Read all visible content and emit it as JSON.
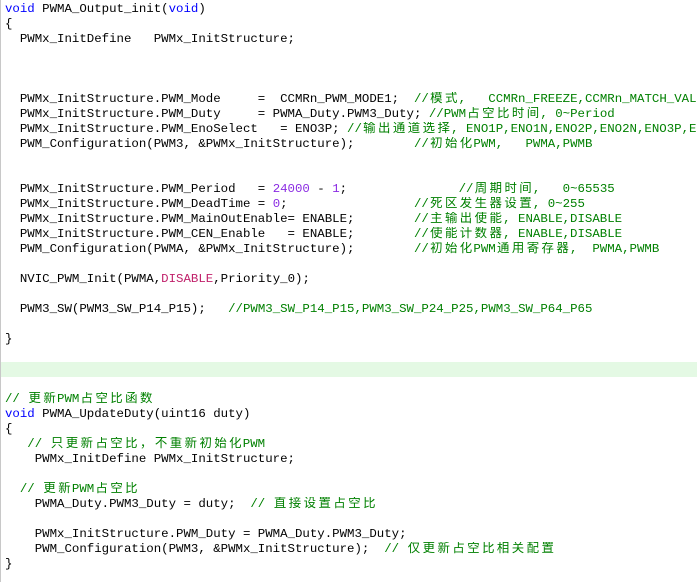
{
  "colors": {
    "background": "#ffffff",
    "text": "#000000",
    "keyword": "#0000ff",
    "comment": "#008000",
    "number": "#8a2be2",
    "constant": "#c0206a",
    "current_line": "#e4f9e4",
    "border": "#c8c8c8"
  },
  "editor": {
    "lines": [
      {
        "tokens": [
          {
            "keyword": "void"
          },
          {
            "code": " PWMA_Output_init("
          },
          {
            "keyword": "void"
          },
          {
            "code": ")"
          }
        ]
      },
      {
        "tokens": [
          {
            "code": "{"
          }
        ]
      },
      {
        "tokens": [
          {
            "code": "  PWMx_InitDefine   PWMx_InitStructure;"
          }
        ]
      },
      {
        "tokens": []
      },
      {
        "tokens": []
      },
      {
        "tokens": []
      },
      {
        "tokens": [
          {
            "code": "  PWMx_InitStructure.PWM_Mode     =  CCMRn_PWM_MODE1;  "
          },
          {
            "comment": "//模式,   CCMRn_FREEZE,CCMRn_MATCH_VAL"
          }
        ]
      },
      {
        "tokens": [
          {
            "code": "  PWMx_InitStructure.PWM_Duty     = PWMA_Duty.PWM3_Duty; "
          },
          {
            "comment": "//PWM占空比时间, 0~Period"
          }
        ]
      },
      {
        "tokens": [
          {
            "code": "  PWMx_InitStructure.PWM_EnoSelect   = ENO3P; "
          },
          {
            "comment": "//输出通道选择, ENO1P,ENO1N,ENO2P,ENO2N,ENO3P,E"
          }
        ]
      },
      {
        "tokens": [
          {
            "code": "  PWM_Configuration(PWM3, &PWMx_InitStructure);        "
          },
          {
            "comment": "//初始化PWM,   PWMA,PWMB"
          }
        ]
      },
      {
        "tokens": []
      },
      {
        "tokens": []
      },
      {
        "tokens": [
          {
            "code": "  PWMx_InitStructure.PWM_Period   = "
          },
          {
            "number": "24000"
          },
          {
            "code": " - "
          },
          {
            "number": "1"
          },
          {
            "code": ";               "
          },
          {
            "comment": "//周期时间,   0~65535"
          }
        ]
      },
      {
        "tokens": [
          {
            "code": "  PWMx_InitStructure.PWM_DeadTime = "
          },
          {
            "number": "0"
          },
          {
            "code": ";                 "
          },
          {
            "comment": "//死区发生器设置, 0~255"
          }
        ]
      },
      {
        "tokens": [
          {
            "code": "  PWMx_InitStructure.PWM_MainOutEnable= ENABLE;        "
          },
          {
            "comment": "//主输出使能, ENABLE,DISABLE"
          }
        ]
      },
      {
        "tokens": [
          {
            "code": "  PWMx_InitStructure.PWM_CEN_Enable   = ENABLE;        "
          },
          {
            "comment": "//使能计数器, ENABLE,DISABLE"
          }
        ]
      },
      {
        "tokens": [
          {
            "code": "  PWM_Configuration(PWMA, &PWMx_InitStructure);        "
          },
          {
            "comment": "//初始化PWM通用寄存器,  PWMA,PWMB"
          }
        ]
      },
      {
        "tokens": []
      },
      {
        "tokens": [
          {
            "code": "  NVIC_PWM_Init(PWMA,"
          },
          {
            "constant": "DISABLE"
          },
          {
            "code": ",Priority_0);"
          }
        ]
      },
      {
        "tokens": []
      },
      {
        "tokens": [
          {
            "code": "  PWM3_SW(PWM3_SW_P14_P15);   "
          },
          {
            "comment": "//PWM3_SW_P14_P15,PWM3_SW_P24_P25,PWM3_SW_P64_P65"
          }
        ]
      },
      {
        "tokens": []
      },
      {
        "tokens": [
          {
            "code": "}"
          }
        ]
      },
      {
        "tokens": []
      },
      {
        "current": true,
        "tokens": []
      },
      {
        "tokens": []
      },
      {
        "tokens": [
          {
            "comment": "// 更新PWM占空比函数"
          }
        ]
      },
      {
        "tokens": [
          {
            "keyword": "void"
          },
          {
            "code": " PWMA_UpdateDuty(uint16 duty)"
          }
        ]
      },
      {
        "tokens": [
          {
            "code": "{"
          }
        ]
      },
      {
        "tokens": [
          {
            "comment": "   // 只更新占空比，不重新初始化PWM"
          }
        ]
      },
      {
        "tokens": [
          {
            "code": "    PWMx_InitDefine PWMx_InitStructure;"
          }
        ]
      },
      {
        "tokens": []
      },
      {
        "tokens": [
          {
            "comment": "  // 更新PWM占空比"
          }
        ]
      },
      {
        "tokens": [
          {
            "code": "    PWMA_Duty.PWM3_Duty = duty;  "
          },
          {
            "comment": "// 直接设置占空比"
          }
        ]
      },
      {
        "tokens": []
      },
      {
        "tokens": [
          {
            "code": "    PWMx_InitStructure.PWM_Duty = PWMA_Duty.PWM3_Duty;"
          }
        ]
      },
      {
        "tokens": [
          {
            "code": "    PWM_Configuration(PWM3, &PWMx_InitStructure);  "
          },
          {
            "comment": "// 仅更新占空比相关配置"
          }
        ]
      },
      {
        "tokens": [
          {
            "code": "}"
          }
        ]
      }
    ]
  }
}
